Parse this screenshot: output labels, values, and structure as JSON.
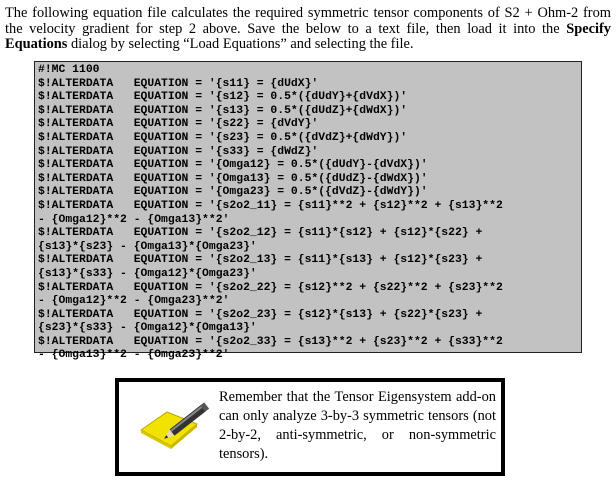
{
  "intro": {
    "text_before_bold": "The following equation file calculates the required symmetric tensor components of S2 + Ohm-2 from the velocity gradient for step 2 above. Save the below to a text file, then load it into the ",
    "bold_text": "Specify Equations",
    "text_after_bold": " dialog by selecting “Load Equations” and selecting the file."
  },
  "code_lines": [
    "#!MC 1100",
    "$!ALTERDATA   EQUATION = '{s11} = {dUdX}'",
    "$!ALTERDATA   EQUATION = '{s12} = 0.5*({dUdY}+{dVdX})'",
    "$!ALTERDATA   EQUATION = '{s13} = 0.5*({dUdZ}+{dWdX})'",
    "$!ALTERDATA   EQUATION = '{s22} = {dVdY}'",
    "$!ALTERDATA   EQUATION = '{s23} = 0.5*({dVdZ}+{dWdY})'",
    "$!ALTERDATA   EQUATION = '{s33} = {dWdZ}'",
    "$!ALTERDATA   EQUATION = '{Omga12} = 0.5*({dUdY}-{dVdX})'",
    "$!ALTERDATA   EQUATION = '{Omga13} = 0.5*({dUdZ}-{dWdX})'",
    "$!ALTERDATA   EQUATION = '{Omga23} = 0.5*({dVdZ}-{dWdY})'",
    "$!ALTERDATA   EQUATION = '{s2o2_11} = {s11}**2 + {s12}**2 + {s13}**2",
    "- {Omga12}**2 - {Omga13}**2'",
    "$!ALTERDATA   EQUATION = '{s2o2_12} = {s11}*{s12} + {s12}*{s22} +",
    "{s13}*{s23} - {Omga13}*{Omga23}'",
    "$!ALTERDATA   EQUATION = '{s2o2_13} = {s11}*{s13} + {s12}*{s23} +",
    "{s13}*{s33} - {Omga12}*{Omga23}'",
    "$!ALTERDATA   EQUATION = '{s2o2_22} = {s12}**2 + {s22}**2 + {s23}**2",
    "- {Omga12}**2 - {Omga23}**2'",
    "$!ALTERDATA   EQUATION = '{s2o2_23} = {s12}*{s13} + {s22}*{s23} +",
    "{s23}*{s33} - {Omga12}*{Omga13}'",
    "$!ALTERDATA   EQUATION = '{s2o2_33} = {s13}**2 + {s23}**2 + {s33}**2",
    "- {Omga13}**2 - {Omga23}**2'"
  ],
  "note": {
    "icon": "notepad-pencil-icon",
    "text": "Remember that the Tensor Eigensystem add-on can only analyze 3-by-3 symmetric tensors (not 2-by-2, anti-symmetric, or non-symmetric tensors)."
  },
  "colors": {
    "code_background": "#c2c2c2",
    "note_icon_yellow": "#f2e200"
  }
}
